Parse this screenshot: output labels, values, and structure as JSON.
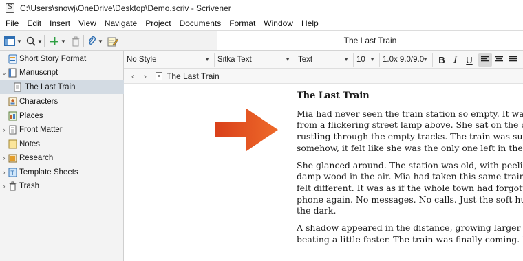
{
  "window": {
    "title": "C:\\Users\\snowj\\OneDrive\\Desktop\\Demo.scriv - Scrivener"
  },
  "menu": [
    "File",
    "Edit",
    "Insert",
    "View",
    "Navigate",
    "Project",
    "Documents",
    "Format",
    "Window",
    "Help"
  ],
  "toolbar": {
    "document_title": "The Last Train"
  },
  "binder": {
    "items": [
      {
        "label": "Short Story Format",
        "icon": "compile-format-icon",
        "disclosure": ""
      },
      {
        "label": "Manuscript",
        "icon": "manuscript-icon",
        "disclosure": "expanded"
      },
      {
        "label": "The Last Train",
        "icon": "document-icon",
        "disclosure": "",
        "selected": true
      },
      {
        "label": "Characters",
        "icon": "characters-icon",
        "disclosure": ""
      },
      {
        "label": "Places",
        "icon": "places-icon",
        "disclosure": ""
      },
      {
        "label": "Front Matter",
        "icon": "front-matter-icon",
        "disclosure": "collapsed"
      },
      {
        "label": "Notes",
        "icon": "notes-icon",
        "disclosure": ""
      },
      {
        "label": "Research",
        "icon": "research-icon",
        "disclosure": "collapsed"
      },
      {
        "label": "Template Sheets",
        "icon": "template-sheets-icon",
        "disclosure": "collapsed"
      },
      {
        "label": "Trash",
        "icon": "trash-icon",
        "disclosure": "collapsed"
      }
    ]
  },
  "format_bar": {
    "style": "No Style",
    "font": "Sitka Text",
    "typeface": "Text",
    "size": "10",
    "line_spacing": "1.0x 9.0/9.0",
    "bold": "B",
    "italic": "I",
    "underline": "U"
  },
  "navigation": {
    "breadcrumb": "The Last Train"
  },
  "editor": {
    "heading": "The Last Train",
    "paragraphs": [
      [
        "Mia had never seen the train station so empty. It was",
        "from a flickering street lamp above. She sat on the co",
        "rustling through the empty tracks. The train was sup",
        "somehow, it felt like she was the only one left in the w"
      ],
      [
        "She glanced around. The station was old, with peelin",
        "damp wood in the air. Mia had taken this same train",
        "felt different. It was as if the whole town had forgott",
        "phone again. No messages. No calls. Just the soft hun",
        "the dark."
      ],
      [
        "A shadow appeared in the distance, growing larger as",
        "beating a little faster. The train was finally coming. B"
      ]
    ]
  },
  "colors": {
    "arrow": "#e8531c",
    "binder_selected": "#d3dbe3",
    "add_button": "#2ea043"
  }
}
